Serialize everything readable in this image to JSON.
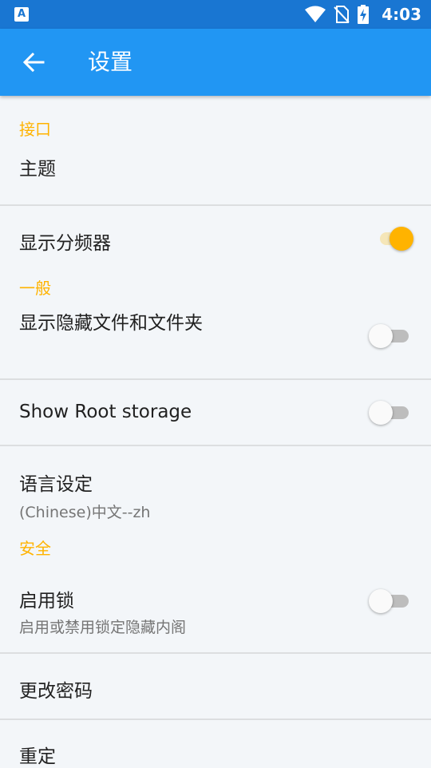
{
  "status_bar": {
    "time": "4:03",
    "app_icon_letter": "A",
    "icons": [
      "wifi-icon",
      "no-sim-icon",
      "battery-charging-icon"
    ]
  },
  "toolbar": {
    "title": "设置",
    "back_icon": "arrow-left-icon"
  },
  "sections": {
    "interface": "接口",
    "general": "一般",
    "security": "安全"
  },
  "items": {
    "theme": {
      "label": "主题"
    },
    "show_divider": {
      "label": "显示分频器",
      "enabled": true
    },
    "show_hidden": {
      "label": "显示隐藏文件和文件夹",
      "enabled": false
    },
    "show_root": {
      "label": "Show Root storage",
      "enabled": false
    },
    "language": {
      "label": "语言设定",
      "value": "(Chinese)中文--zh"
    },
    "enable_lock": {
      "label": "启用锁",
      "summary": "启用或禁用锁定隐藏内阁",
      "enabled": false
    },
    "change_password": {
      "label": "更改密码"
    },
    "reset": {
      "label": "重定"
    }
  },
  "colors": {
    "status_bar": "#1976d2",
    "toolbar": "#2196f3",
    "accent": "#ffb300",
    "background": "#f3f6f9"
  }
}
